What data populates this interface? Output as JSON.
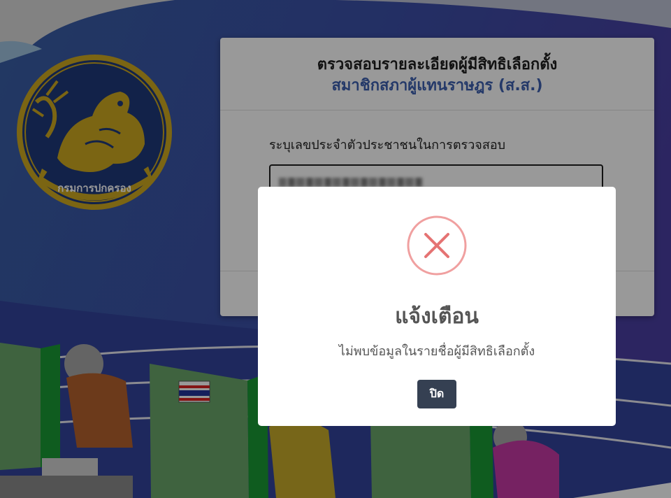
{
  "card": {
    "title": "ตรวจสอบรายละเอียดผู้มีสิทธิเลือกตั้ง",
    "subtitle": "สมาชิกสภาผู้แทนราษฎร (ส.ส.)",
    "id_label": "ระบุเลขประจำตัวประชาชนในการตรวจสอบ"
  },
  "emblem": {
    "text": "กรมการปกครอง",
    "icon": "department-emblem"
  },
  "modal": {
    "icon": "error-x-icon",
    "title": "แจ้งเตือน",
    "message": "ไม่พบข้อมูลในรายชื่อผู้มีสิทธิเลือกตั้ง",
    "close_label": "ปิด"
  },
  "colors": {
    "background_blue": "#3a52a8",
    "subtitle_blue": "#3d5fb0",
    "error_red": "#e57373",
    "button_dark": "#354052"
  }
}
